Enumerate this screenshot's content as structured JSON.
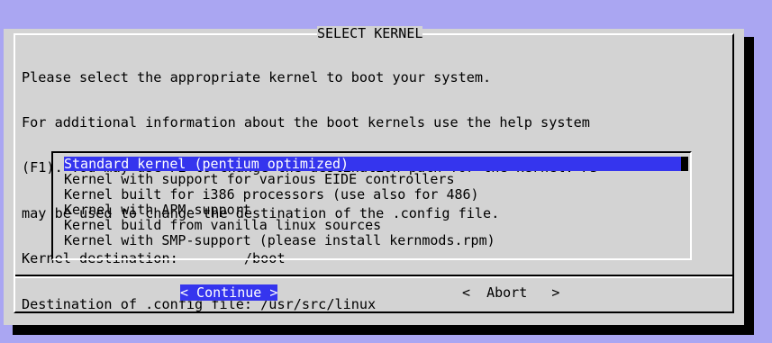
{
  "dialog": {
    "title": "SELECT KERNEL",
    "message_lines": [
      "Please select the appropriate kernel to boot your system.",
      "For additional information about the boot kernels use the help system",
      "(F1). You may use F2 to change the destination path for the kernel. F3",
      "may be used to change the destination of the .config file.",
      "Kernel destination:        /boot",
      "Destination of .config file: /usr/src/linux"
    ],
    "kernels": [
      {
        "label": "Standard kernel (pentium optimized)",
        "selected": true
      },
      {
        "label": "Kernel with support for various EIDE controllers",
        "selected": false
      },
      {
        "label": "Kernel built for i386 processors (use also for 486)",
        "selected": false
      },
      {
        "label": "Kernel with APM-support",
        "selected": false
      },
      {
        "label": "Kernel build from vanilla linux sources",
        "selected": false
      },
      {
        "label": "Kernel with SMP-support (please install kernmods.rpm)",
        "selected": false
      }
    ],
    "buttons": {
      "continue": "< Continue >",
      "abort": "<  Abort   >"
    }
  },
  "colors": {
    "background": "#aaa6f2",
    "dialog": "#d3d3d3",
    "highlight": "#3535ee"
  }
}
